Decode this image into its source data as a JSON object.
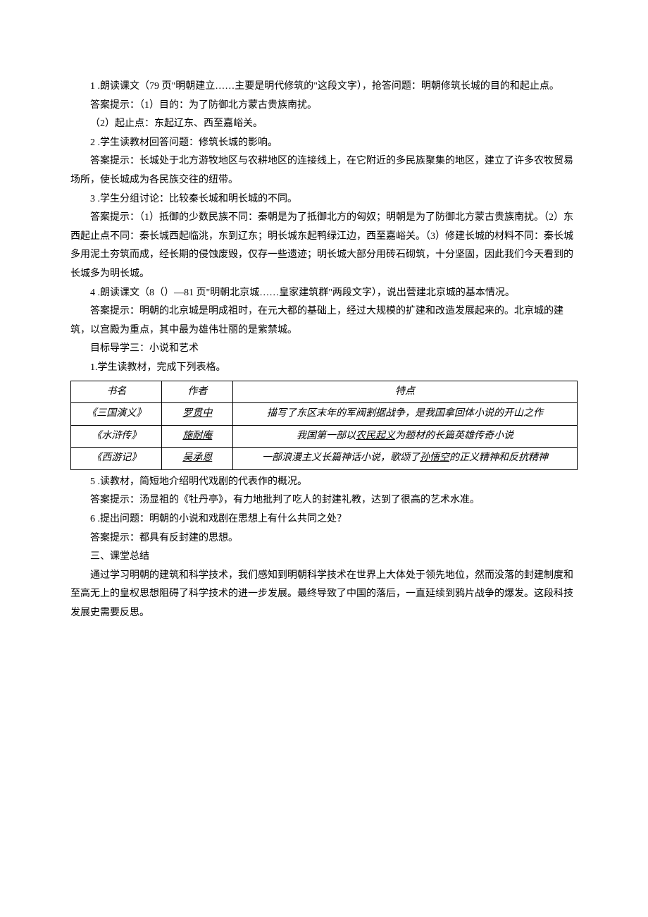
{
  "paragraphs": {
    "p1": "1   .朗读课文（79 页\"明朝建立……主要是明代修筑的\"这段文字），抢答问题：明朝修筑长城的目的和起止点。",
    "p2": "答案提示：（1）目的：为了防御北方蒙古贵族南扰。",
    "p3": "（2）起止点：东起辽东、西至嘉峪关。",
    "p4": "2       .学生读教材回答问题：修筑长城的影响。",
    "p5": "答案提示：长城处于北方游牧地区与农耕地区的连接线上，在它附近的多民族聚集的地区，建立了许多农牧贸易场所，使长城成为各民族交往的纽带。",
    "p6": "3       .学生分组讨论：比较秦长城和明长城的不同。",
    "p7": "答案提示：（1）抵御的少数民族不同：秦朝是为了抵御北方的匈奴；明朝是为了防御北方蒙古贵族南扰。（2）东西起止点不同：秦长城西起临洮，东到辽东；明长城东起鸭绿江边，西至嘉峪关。（3）修建长城的材料不同：秦长城多用泥土夯筑而成，经长期的侵蚀废毁，仅存一些遗迹；明长城大部分用砖石砌筑，十分坚固，因此我们今天看到的长城多为明长城。",
    "p8": "4   .朗读课文（8（）—81 页\"明朝北京城……皇家建筑群\"两段文字），说出营建北京城的基本情况。",
    "p9": "答案提示：明朝的北京城是明成祖时，在元大都的基础上，经过大规模的扩建和改造发展起来的。北京城的建筑，以宫殿为重点，其中最为雄伟壮丽的是紫禁城。",
    "p10": "目标导学三：小说和艺术",
    "p11": "1.学生读教材，完成下列表格。",
    "p12": "5       .读教材，简短地介绍明代戏剧的代表作的概况。",
    "p13": "答案提示：汤显祖的《牡丹亭》，有力地批判了吃人的封建礼教，达到了很高的艺术水准。",
    "p14": "6       .提出问题：明朝的小说和戏剧在思想上有什么共同之处？",
    "p15": "答案提示：都具有反封建的思想。",
    "p16": "三、课堂总结",
    "p17": "通过学习明朝的建筑和科学技术，我们感知到明朝科学技术在世界上大体处于领先地位，然而没落的封建制度和至高无上的皇权思想阻碍了科学技术的进一步发展。最终导致了中国的落后，一直延续到鸦片战争的爆发。这段科技发展史需要反思。"
  },
  "table": {
    "headers": {
      "col1": "书名",
      "col2": "作者",
      "col3": "特点"
    },
    "rows": [
      {
        "book": "《三国演义》",
        "author": "罗贯中",
        "feature_pre": "描写了东区末年的军阀割据战争，是我国拿回体小说的开山之作",
        "feature_underline": "",
        "feature_post": ""
      },
      {
        "book": "《水浒传》",
        "author": "施耐庵",
        "feature_pre": "我国第一部以",
        "feature_underline": "农民起义",
        "feature_post": "为题材的长篇英雄传奇小说"
      },
      {
        "book": "《西游记》",
        "author": "吴承恩",
        "feature_pre": "一部浪漫主义长篇神话小说，歌颂了",
        "feature_underline": "孙悟空",
        "feature_post": "的正义精神和反抗精神"
      }
    ]
  }
}
